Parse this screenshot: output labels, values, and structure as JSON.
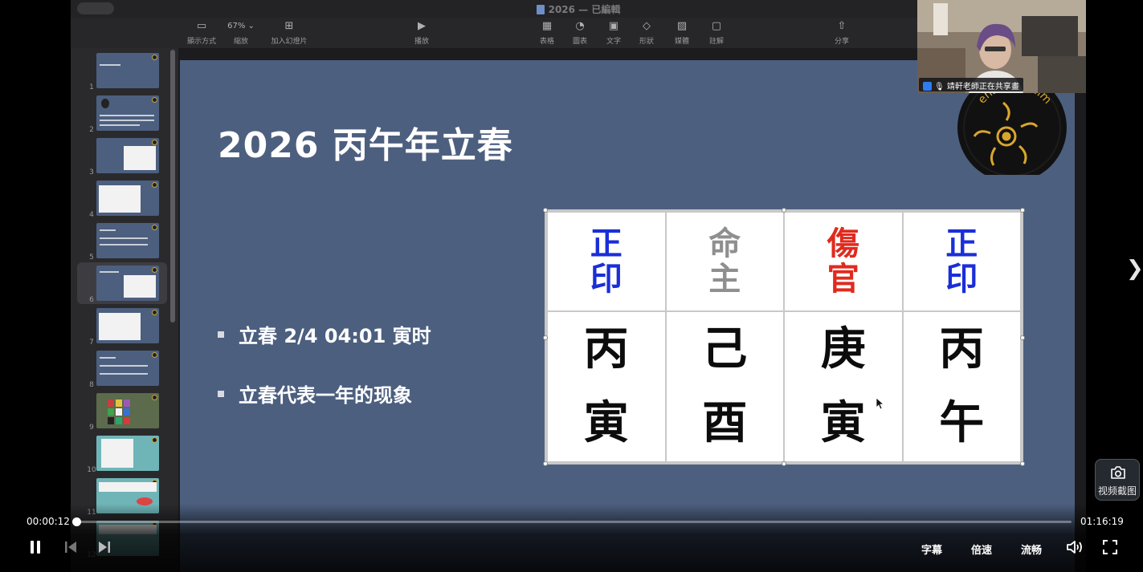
{
  "keynote": {
    "doc_title": "2026 — 已編輯",
    "toolbar": [
      {
        "icon": "sidebar-view-icon",
        "label": "顯示方式"
      },
      {
        "icon": "zoom-icon",
        "label": "縮放"
      },
      {
        "icon": "add-slide-icon",
        "label": "加入幻燈片"
      },
      {
        "icon": "play-icon",
        "label": "播放"
      },
      {
        "icon": "table-icon",
        "label": "表格"
      },
      {
        "icon": "chart-icon",
        "label": "圖表"
      },
      {
        "icon": "text-icon",
        "label": "文字"
      },
      {
        "icon": "shape-icon",
        "label": "形狀"
      },
      {
        "icon": "media-icon",
        "label": "媒體"
      },
      {
        "icon": "comment-icon",
        "label": "註解"
      },
      {
        "icon": "share-icon",
        "label": "分享"
      }
    ],
    "zoom_value": "67%",
    "slides": [
      "1",
      "2",
      "3",
      "4",
      "5",
      "6",
      "7",
      "8",
      "9",
      "10",
      "11",
      "12"
    ],
    "selected_slide": "6"
  },
  "slide": {
    "title": "2026 丙午年立春",
    "bullets": [
      "立春 2/4 04:01 寅时",
      "立春代表一年的现象"
    ],
    "table": {
      "ten_gods": [
        {
          "text": "正印",
          "color": "#1a2ed8"
        },
        {
          "text": "命主",
          "color": "#8f8f8f"
        },
        {
          "text": "傷官",
          "color": "#e02a1e"
        },
        {
          "text": "正印",
          "color": "#1a2ed8"
        }
      ],
      "stems": [
        "丙",
        "己",
        "庚",
        "丙"
      ],
      "branches": [
        "寅",
        "酉",
        "寅",
        "午"
      ]
    },
    "logo_text": "ensightrealm"
  },
  "webcam": {
    "label": "靖軒老師正在共享畫"
  },
  "side": {
    "screenshot_label": "视频截图"
  },
  "player": {
    "current_time": "00:00:12",
    "total_time": "01:16:19",
    "progress_fraction": 0.0026,
    "subtitle_label": "字幕",
    "speed_label": "倍速",
    "quality_label": "流畅"
  }
}
